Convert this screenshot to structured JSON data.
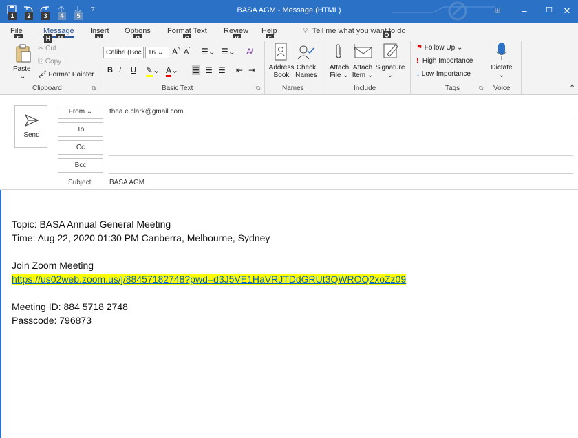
{
  "window": {
    "title": "BASA AGM  -  Message (HTML)",
    "minimize": "–",
    "maximize": "☐",
    "close": "✕",
    "ribbon_display": "⊞"
  },
  "qat_keytips": [
    "1",
    "2",
    "3",
    "4",
    "5"
  ],
  "tabs": [
    {
      "label": "File",
      "keytip": "F"
    },
    {
      "label": "Message",
      "keytip": "H"
    },
    {
      "label": "Insert",
      "keytip": "N"
    },
    {
      "label": "Options",
      "keytip": "P"
    },
    {
      "label": "Format Text",
      "keytip": "O"
    },
    {
      "label": "Review",
      "keytip": "V"
    },
    {
      "label": "Help",
      "keytip": "E"
    }
  ],
  "tell_me": {
    "text": "Tell me what you want to do",
    "keytip": "Q"
  },
  "ribbon": {
    "clipboard": {
      "label": "Clipboard",
      "paste": "Paste",
      "cut": "Cut",
      "copy": "Copy",
      "format_painter": "Format Painter"
    },
    "basic_text": {
      "label": "Basic Text",
      "font": "Calibri (Boc",
      "size": "16",
      "bold": "B",
      "italic": "I",
      "underline": "U"
    },
    "names": {
      "label": "Names",
      "address_book_1": "Address",
      "address_book_2": "Book",
      "check_names_1": "Check",
      "check_names_2": "Names"
    },
    "include": {
      "label": "Include",
      "attach_file_1": "Attach",
      "attach_file_2": "File",
      "attach_item_1": "Attach",
      "attach_item_2": "Item",
      "signature": "Signature"
    },
    "tags": {
      "label": "Tags",
      "follow_up": "Follow Up",
      "high": "High Importance",
      "low": "Low Importance"
    },
    "voice": {
      "label": "Voice",
      "dictate": "Dictate"
    }
  },
  "header": {
    "send": "Send",
    "from_label": "From",
    "from_value": "thea.e.clark@gmail.com",
    "to_label": "To",
    "cc_label": "Cc",
    "bcc_label": "Bcc",
    "subject_label": "Subject",
    "subject_value": "BASA AGM"
  },
  "body": {
    "topic": "Topic: BASA Annual General Meeting",
    "time": "Time: Aug 22, 2020 01:30 PM Canberra, Melbourne, Sydney",
    "join": "Join Zoom Meeting",
    "link": "https://us02web.zoom.us/j/88457182748?pwd=d3J5VE1HaVRJTDdGRUt3QWROQ2xoZz09",
    "meeting_id": "Meeting ID: 884 5718 2748",
    "passcode": "Passcode: 796873"
  },
  "colors": {
    "accent": "#2b72c6",
    "link": "#0563c1",
    "highlight": "#ffff00"
  }
}
